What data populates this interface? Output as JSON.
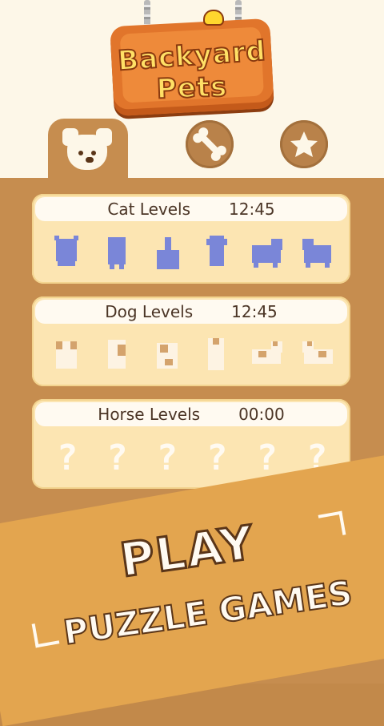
{
  "logo": {
    "line1": "Backyard",
    "line2": "Pets"
  },
  "tabs": [
    {
      "icon": "dog-face-icon"
    },
    {
      "icon": "bone-icon"
    },
    {
      "icon": "star-icon"
    }
  ],
  "levels": [
    {
      "title": "Cat Levels",
      "time": "12:45",
      "icons": [
        "cat-icon",
        "cat-icon",
        "cat-icon",
        "cat-icon",
        "cat-icon",
        "cat-icon"
      ]
    },
    {
      "title": "Dog Levels",
      "time": "12:45",
      "icons": [
        "dog-icon",
        "dog-icon",
        "dog-icon",
        "dog-icon",
        "dog-icon",
        "dog-icon"
      ]
    },
    {
      "title": "Horse Levels",
      "time": "00:00",
      "icons": [
        "?",
        "?",
        "?",
        "?",
        "?",
        "?"
      ]
    }
  ],
  "promo": {
    "line1": "PLAY",
    "line2": "PUZZLE GAMES"
  },
  "colors": {
    "accent": "#c68d4f",
    "panel": "#fce5b2",
    "cat": "#7a86d8",
    "dog": "#d4a36c"
  }
}
